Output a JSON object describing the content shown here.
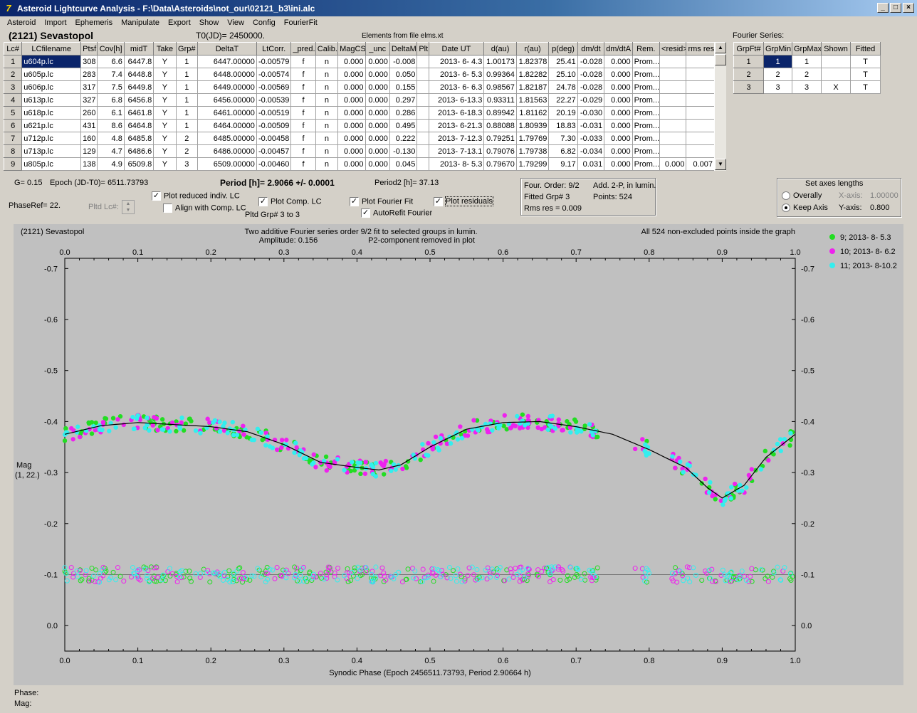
{
  "window": {
    "title": "Asteroid Lightcurve Analysis - F:\\Data\\Asteroids\\not_our\\02121_b3\\ini.alc"
  },
  "menu": [
    "Asteroid",
    "Import",
    "Ephemeris",
    "Manipulate",
    "Export",
    "Show",
    "View",
    "Config",
    "FourierFit"
  ],
  "header": {
    "asteroid": "(2121) Sevastopol",
    "t0": "T0(JD)= 2450000.",
    "elements": "Elements from file elms.xt",
    "fourier_label": "Fourier Series:"
  },
  "lc_table": {
    "columns": [
      "Lc#",
      "LCfilename",
      "Ptsf",
      "Cov[h]",
      "midT",
      "Take",
      "Grp#",
      "DeltaT",
      "LtCorr.",
      "_pred.",
      "Calib.",
      "MagCS",
      "_unc",
      "DeltaM",
      "Plt",
      "Date UT",
      "d(au)",
      "r(au)",
      "p(deg)",
      "dm/dt",
      "dm/dtA",
      "Rem.",
      "<resid>",
      "rms res"
    ],
    "rows": [
      [
        "1",
        "u604p.lc",
        "308",
        "6.6",
        "6447.8",
        "Y",
        "1",
        "6447.00000",
        "-0.00579",
        "f",
        "n",
        "0.000",
        "0.000",
        "-0.008",
        "",
        "2013- 6- 4.3",
        "1.00173",
        "1.82378",
        "25.41",
        "-0.028",
        "0.000",
        "Prom...",
        "",
        ""
      ],
      [
        "2",
        "u605p.lc",
        "283",
        "7.4",
        "6448.8",
        "Y",
        "1",
        "6448.00000",
        "-0.00574",
        "f",
        "n",
        "0.000",
        "0.000",
        "0.050",
        "",
        "2013- 6- 5.3",
        "0.99364",
        "1.82282",
        "25.10",
        "-0.028",
        "0.000",
        "Prom...",
        "",
        ""
      ],
      [
        "3",
        "u606p.lc",
        "317",
        "7.5",
        "6449.8",
        "Y",
        "1",
        "6449.00000",
        "-0.00569",
        "f",
        "n",
        "0.000",
        "0.000",
        "0.155",
        "",
        "2013- 6- 6.3",
        "0.98567",
        "1.82187",
        "24.78",
        "-0.028",
        "0.000",
        "Prom...",
        "",
        ""
      ],
      [
        "4",
        "u613p.lc",
        "327",
        "6.8",
        "6456.8",
        "Y",
        "1",
        "6456.00000",
        "-0.00539",
        "f",
        "n",
        "0.000",
        "0.000",
        "0.297",
        "",
        "2013- 6-13.3",
        "0.93311",
        "1.81563",
        "22.27",
        "-0.029",
        "0.000",
        "Prom...",
        "",
        ""
      ],
      [
        "5",
        "u618p.lc",
        "260",
        "6.1",
        "6461.8",
        "Y",
        "1",
        "6461.00000",
        "-0.00519",
        "f",
        "n",
        "0.000",
        "0.000",
        "0.286",
        "",
        "2013- 6-18.3",
        "0.89942",
        "1.81162",
        "20.19",
        "-0.030",
        "0.000",
        "Prom...",
        "",
        ""
      ],
      [
        "6",
        "u621p.lc",
        "431",
        "8.6",
        "6464.8",
        "Y",
        "1",
        "6464.00000",
        "-0.00509",
        "f",
        "n",
        "0.000",
        "0.000",
        "0.495",
        "",
        "2013- 6-21.3",
        "0.88088",
        "1.80939",
        "18.83",
        "-0.031",
        "0.000",
        "Prom...",
        "",
        ""
      ],
      [
        "7",
        "u712p.lc",
        "160",
        "4.8",
        "6485.8",
        "Y",
        "2",
        "6485.00000",
        "-0.00458",
        "f",
        "n",
        "0.000",
        "0.000",
        "0.222",
        "",
        "2013- 7-12.3",
        "0.79251",
        "1.79769",
        "7.30",
        "-0.033",
        "0.000",
        "Prom...",
        "",
        ""
      ],
      [
        "8",
        "u713p.lc",
        "129",
        "4.7",
        "6486.6",
        "Y",
        "2",
        "6486.00000",
        "-0.00457",
        "f",
        "n",
        "0.000",
        "0.000",
        "-0.130",
        "",
        "2013- 7-13.1",
        "0.79076",
        "1.79738",
        "6.82",
        "-0.034",
        "0.000",
        "Prom...",
        "",
        ""
      ],
      [
        "9",
        "u805p.lc",
        "138",
        "4.9",
        "6509.8",
        "Y",
        "3",
        "6509.00000",
        "-0.00460",
        "f",
        "n",
        "0.000",
        "0.000",
        "0.045",
        "",
        "2013- 8- 5.3",
        "0.79670",
        "1.79299",
        "9.17",
        "0.031",
        "0.000",
        "Prom...",
        "0.000",
        "0.007"
      ]
    ]
  },
  "fourier_table": {
    "columns": [
      "GrpFt#",
      "GrpMin",
      "GrpMax",
      "Shown",
      "Fitted"
    ],
    "rows": [
      [
        "1",
        "1",
        "1",
        "",
        "T"
      ],
      [
        "2",
        "2",
        "2",
        "",
        "T"
      ],
      [
        "3",
        "3",
        "3",
        "X",
        "T"
      ]
    ]
  },
  "controls": {
    "g": "G= 0.15",
    "epoch": "Epoch (JD-T0)= 6511.73793",
    "period": "Period [h]= 2.9066 +/- 0.0001",
    "period2": "Period2 [h]= 37.13",
    "phaseref": "PhaseRef= 22.",
    "pltd_lc": "Pltd Lc#:",
    "cb_reduced": "Plot reduced indiv. LC",
    "cb_align": "Align with Comp. LC",
    "cb_comp": "Plot Comp. LC",
    "cb_fourier": "Plot Fourier Fit",
    "cb_refit": "AutoRefit Fourier",
    "cb_resid": "Plot residuals",
    "pltd_grp": "Pltd Grp#  3   to   3",
    "info_order": "Four. Order:  9/2",
    "info_add": "Add. 2-P, in lumin.",
    "info_fitted": "Fitted Grp# 3",
    "info_points": "Points: 524",
    "info_rms": "Rms res     = 0.009",
    "axes_title": "Set axes lengths",
    "axes_overall": "Overally",
    "axes_keep": "Keep Axis",
    "xaxis_label": "X-axis:",
    "xaxis_val": "1.00000",
    "yaxis_label": "Y-axis:",
    "yaxis_val": "0.800"
  },
  "plot": {
    "name": "(2121) Sevastopol",
    "title1": "Two additive Fourier series order 9/2 fit to selected groups in lumin.",
    "title2": "Amplitude: 0.156",
    "title3": "P2-component removed in plot",
    "note": "All 524 non-excluded points inside the graph",
    "ylabel1": "Mag",
    "ylabel2": "(1, 22.)",
    "xlabel": "Synodic Phase (Epoch 2456511.73793, Period 2.90664 h)",
    "legend": [
      {
        "name": "9; 2013- 8- 5.3",
        "color": "#22dd22"
      },
      {
        "name": "10; 2013- 8- 6.2",
        "color": "#ee22ee"
      },
      {
        "name": "11; 2013- 8-10.2",
        "color": "#33eeee"
      }
    ]
  },
  "chart_data": {
    "type": "scatter",
    "xlim": [
      0,
      1
    ],
    "ylim": [
      0.05,
      -0.72
    ],
    "xticks": [
      "0.0",
      "0.1",
      "0.2",
      "0.3",
      "0.4",
      "0.5",
      "0.6",
      "0.7",
      "0.8",
      "0.9",
      "1.0"
    ],
    "yticks": [
      "-0.7",
      "-0.6",
      "-0.5",
      "-0.4",
      "-0.3",
      "-0.2",
      "-0.1",
      "0.0"
    ],
    "fourier_fit": {
      "x": [
        0,
        0.05,
        0.1,
        0.15,
        0.2,
        0.25,
        0.3,
        0.35,
        0.4,
        0.43,
        0.46,
        0.5,
        0.55,
        0.6,
        0.65,
        0.7,
        0.75,
        0.8,
        0.85,
        0.88,
        0.9,
        0.93,
        0.96,
        1.0
      ],
      "y": [
        -0.375,
        -0.392,
        -0.398,
        -0.394,
        -0.39,
        -0.38,
        -0.355,
        -0.32,
        -0.31,
        -0.305,
        -0.315,
        -0.35,
        -0.385,
        -0.398,
        -0.4,
        -0.39,
        -0.375,
        -0.345,
        -0.31,
        -0.27,
        -0.25,
        -0.275,
        -0.33,
        -0.375
      ]
    },
    "residual_level": -0.1,
    "series": [
      {
        "name": "9; 2013- 8- 5.3"
      },
      {
        "name": "10; 2013- 8- 6.2"
      },
      {
        "name": "11; 2013- 8-10.2"
      }
    ]
  }
}
